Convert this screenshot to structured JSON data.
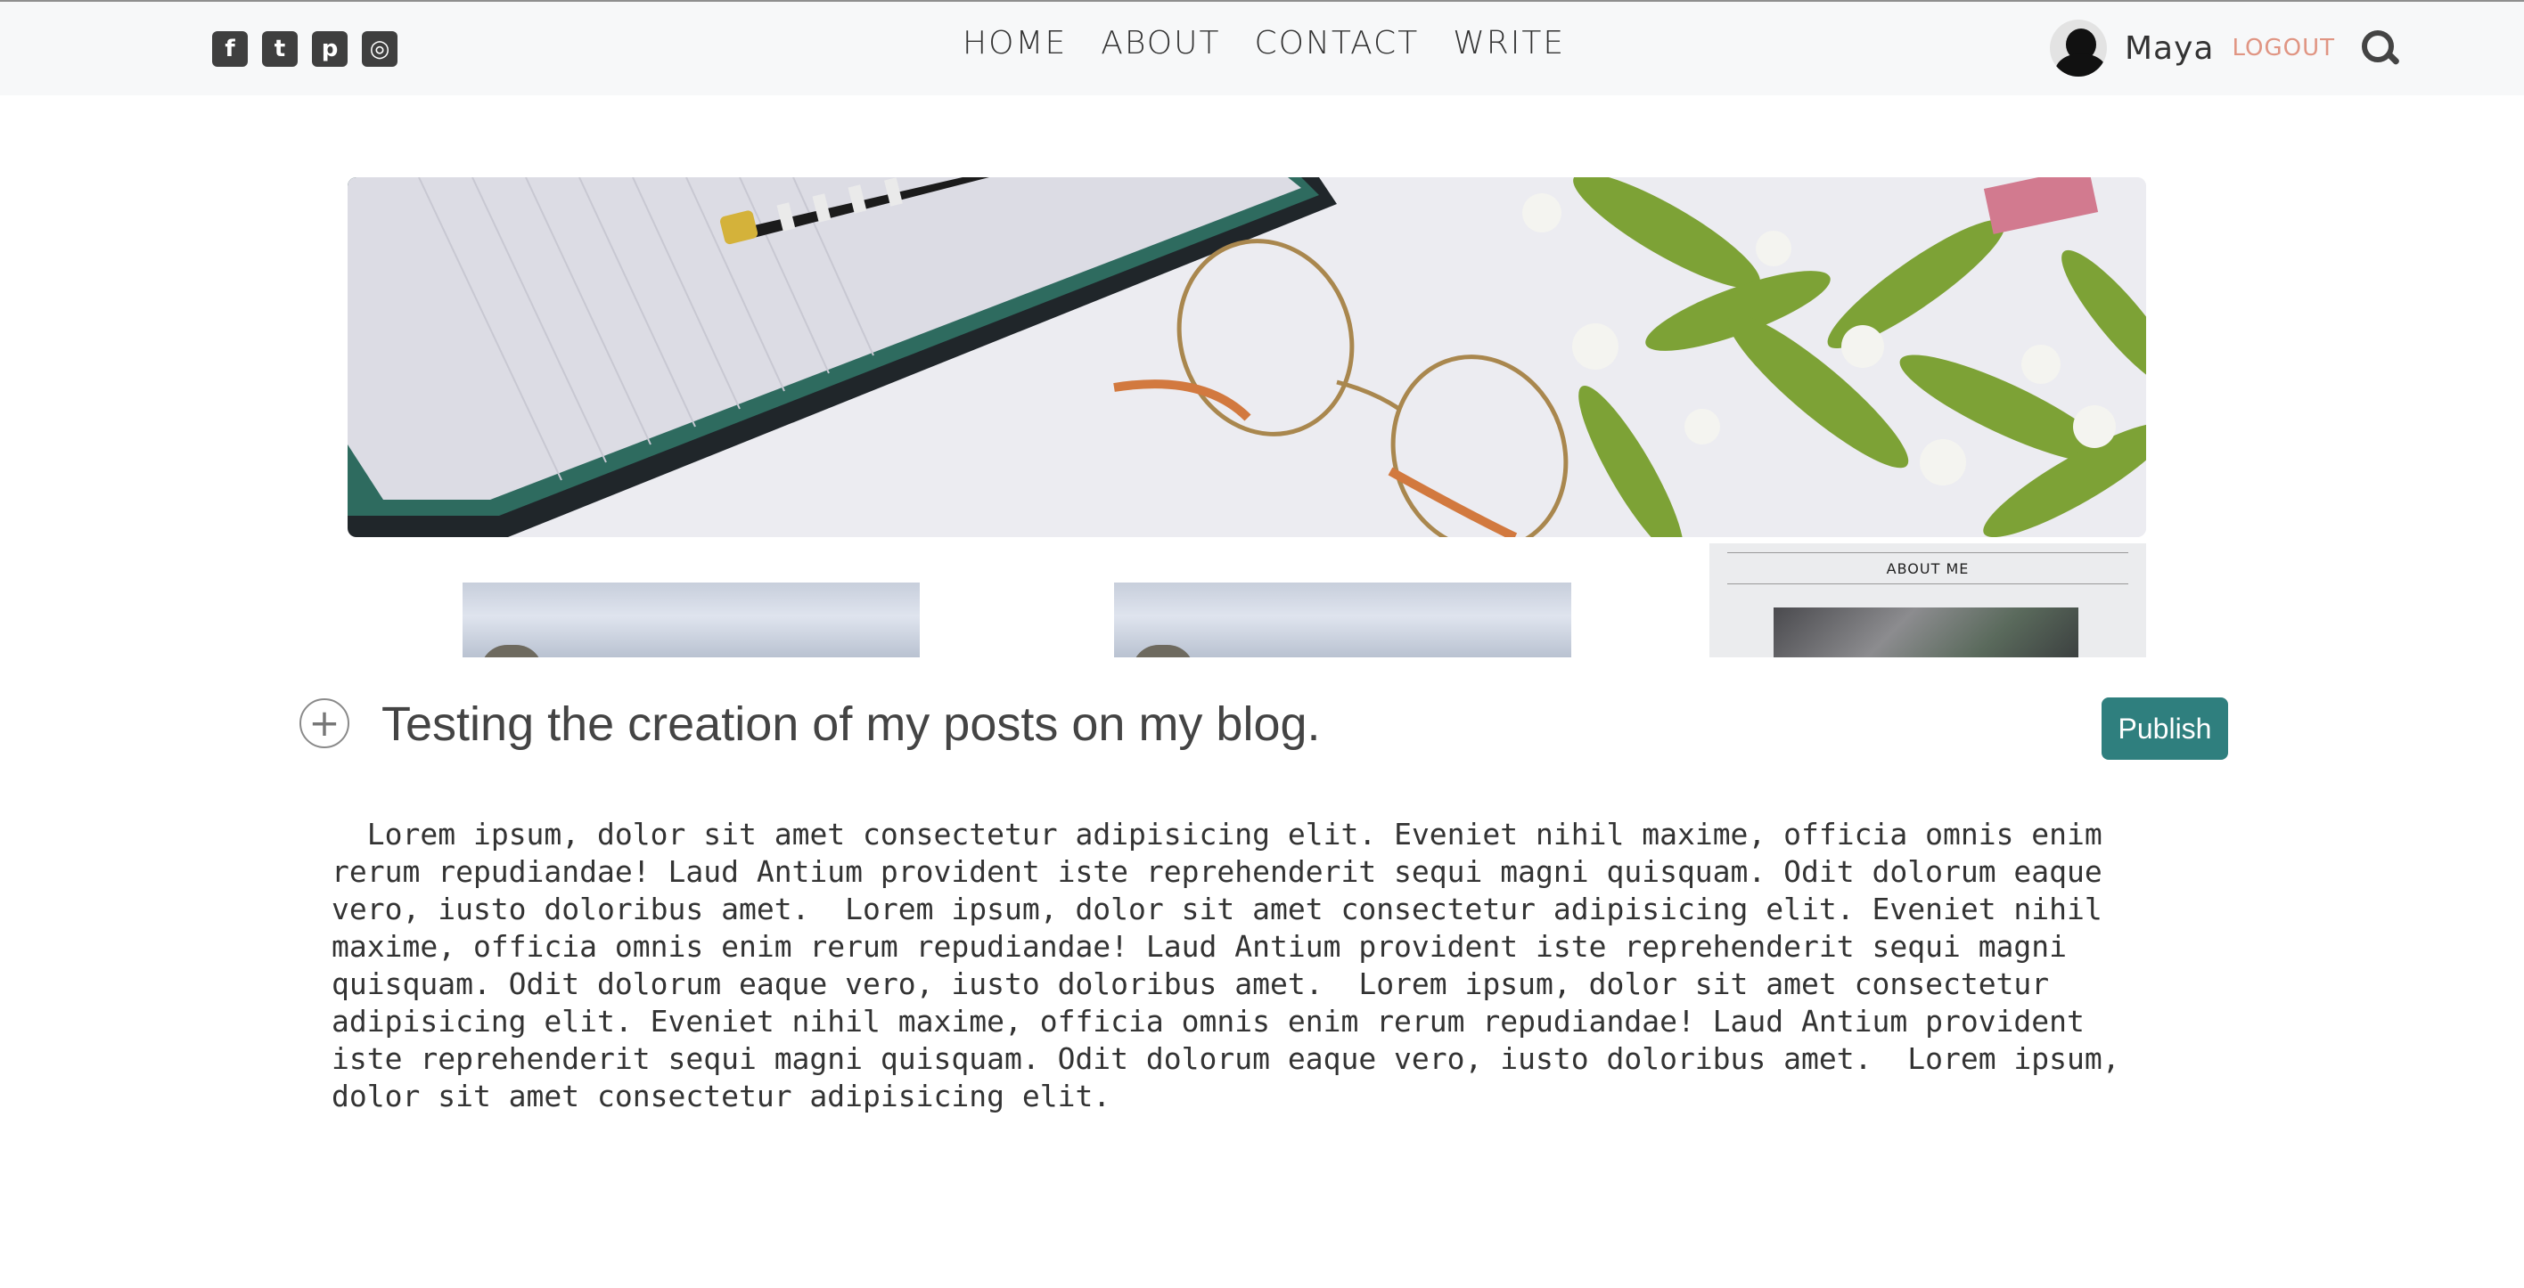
{
  "social": {
    "items": [
      {
        "icon": "facebook-square-icon",
        "glyph": "f"
      },
      {
        "icon": "twitter-square-icon",
        "glyph": "t"
      },
      {
        "icon": "pinterest-square-icon",
        "glyph": "p"
      },
      {
        "icon": "instagram-square-icon",
        "glyph": "◎"
      }
    ],
    "color": "#3f3f3f"
  },
  "nav": {
    "home": "HOME",
    "about": "ABOUT",
    "contact": "CONTACT",
    "write": "WRITE"
  },
  "user": {
    "name": "Maya",
    "logout_label": "LOGOUT",
    "logout_color": "#e09583"
  },
  "sidebar": {
    "about_title": "ABOUT ME"
  },
  "editor": {
    "title_value": "Testing the creation of my posts on my blog.",
    "add_icon": "plus-circle-icon",
    "publish_label": "Publish",
    "publish_color": "#2f7f7e",
    "story_value": "  Lorem ipsum, dolor sit amet consectetur adipisicing elit. Eveniet nihil maxime, officia omnis enim rerum repudiandae! Laud Antium provident iste reprehenderit sequi magni quisquam. Odit dolorum eaque vero, iusto doloribus amet.  Lorem ipsum, dolor sit amet consectetur adipisicing elit. Eveniet nihil maxime, officia omnis enim rerum repudiandae! Laud Antium provident iste reprehenderit sequi magni quisquam. Odit dolorum eaque vero, iusto doloribus amet.  Lorem ipsum, dolor sit amet consectetur adipisicing elit. Eveniet nihil maxime, officia omnis enim rerum repudiandae! Laud Antium provident iste reprehenderit sequi magni quisquam. Odit dolorum eaque vero, iusto doloribus amet.  Lorem ipsum, dolor sit amet consectetur adipisicing elit."
  }
}
